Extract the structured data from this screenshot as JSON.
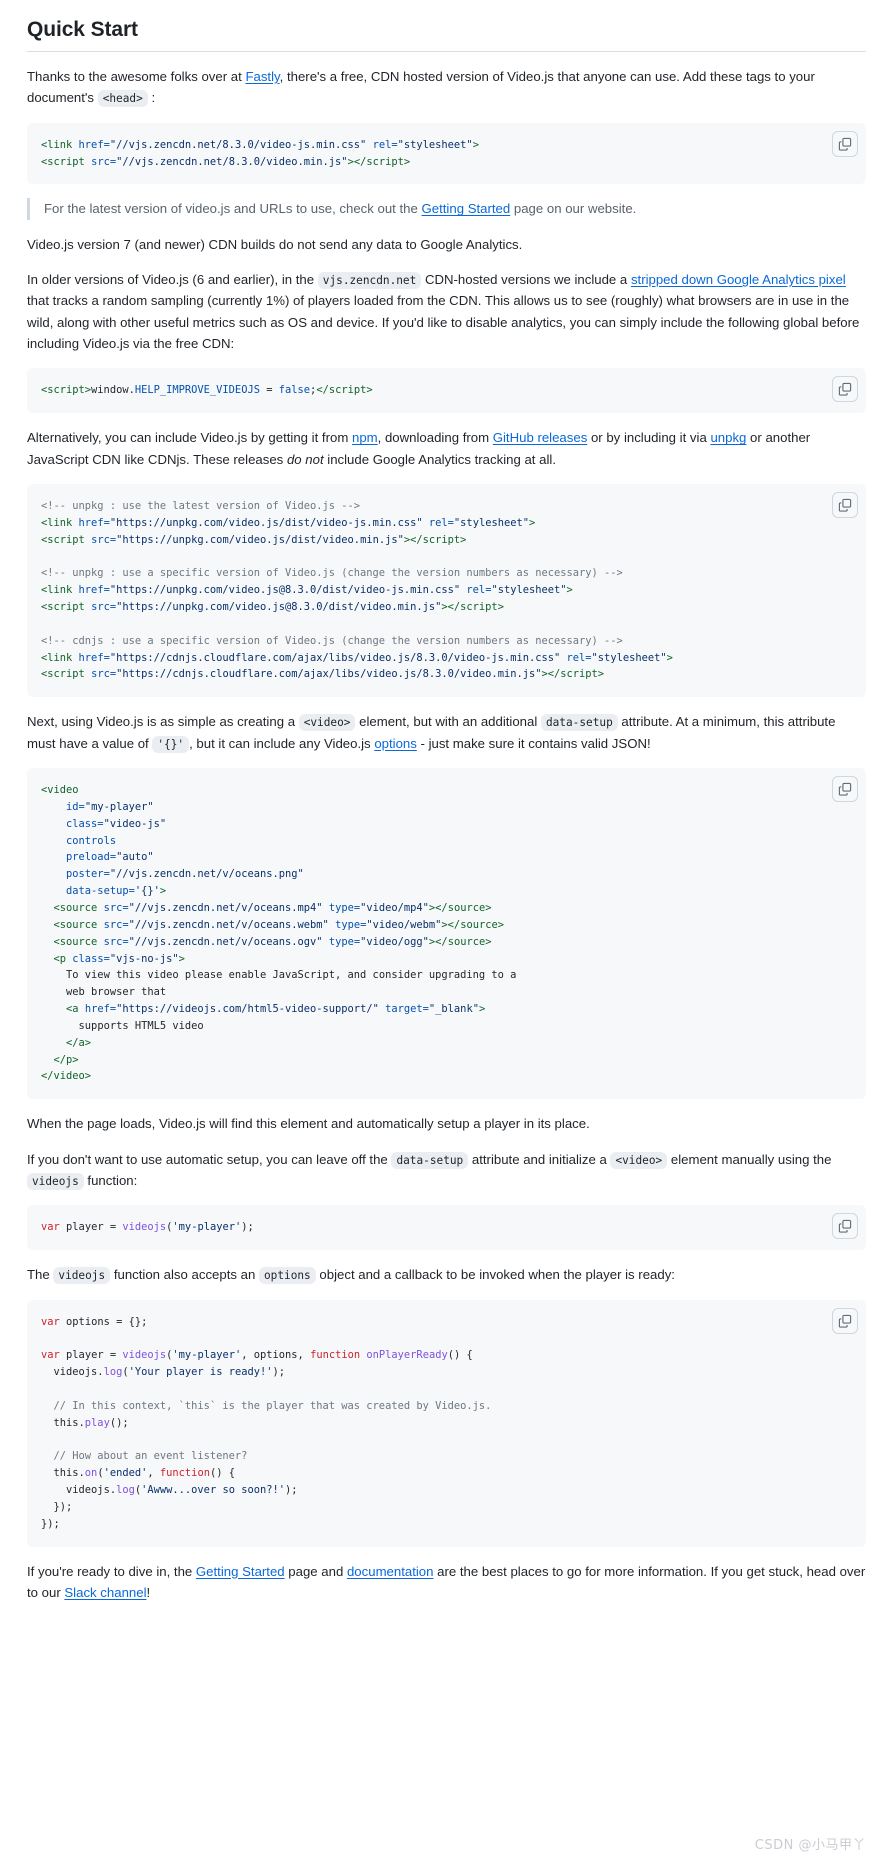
{
  "page": {
    "title": "Quick Start",
    "watermark": "CSDN @小马甲丫"
  },
  "icons": {
    "copy": "copy-icon"
  },
  "paragraphs": {
    "intro_1": "Thanks to the awesome folks over at ",
    "intro_link_fastly": "Fastly",
    "intro_2": ", there's a free, CDN hosted version of Video.js that anyone can use. Add these tags to your document's ",
    "intro_code_head": "<head>",
    "intro_3": " :",
    "note_1": "For the latest version of video.js and URLs to use, check out the ",
    "note_link": "Getting Started",
    "note_2": " page on our website.",
    "analytics_v7": "Video.js version 7 (and newer) CDN builds do not send any data to Google Analytics.",
    "older_1": "In older versions of Video.js (6 and earlier), in the ",
    "older_code_cdn": "vjs.zencdn.net",
    "older_2": " CDN-hosted versions we include a ",
    "older_link_ga": "stripped down Google Analytics pixel",
    "older_3": " that tracks a random sampling (currently 1%) of players loaded from the CDN. This allows us to see (roughly) what browsers are in use in the wild, along with other useful metrics such as OS and device. If you'd like to disable analytics, you can simply include the following global before including Video.js via the free CDN:",
    "alt_1": "Alternatively, you can include Video.js by getting it from ",
    "alt_link_npm": "npm",
    "alt_2": ", downloading from ",
    "alt_link_github": "GitHub releases",
    "alt_3": " or by including it via ",
    "alt_link_unpkg": "unpkg",
    "alt_4": " or another JavaScript CDN like CDNjs. These releases ",
    "alt_emph": "do not",
    "alt_5": " include Google Analytics tracking at all.",
    "next_1": "Next, using Video.js is as simple as creating a ",
    "next_code_video": "<video>",
    "next_2": " element, but with an additional ",
    "next_code_datasetup": "data-setup",
    "next_3": " attribute. At a minimum, this attribute must have a value of ",
    "next_code_brace": "'{}'",
    "next_4": ", but it can include any Video.js ",
    "next_link_options": "options",
    "next_5": " - just make sure it contains valid JSON!",
    "onload": "When the page loads, Video.js will find this element and automatically setup a player in its place.",
    "manual_1": "If you don't want to use automatic setup, you can leave off the ",
    "manual_code_datasetup": "data-setup",
    "manual_2": " attribute and initialize a ",
    "manual_code_video": "<video>",
    "manual_3": " element manually using the ",
    "manual_code_videojs": "videojs",
    "manual_4": " function:",
    "cb_1": "The ",
    "cb_code_videojs": "videojs",
    "cb_2": " function also accepts an ",
    "cb_code_options": "options",
    "cb_3": " object and a callback to be invoked when the player is ready:",
    "final_1": "If you're ready to dive in, the ",
    "final_link_getting": "Getting Started",
    "final_2": " page and ",
    "final_link_docs": "documentation",
    "final_3": " are the best places to go for more information. If you get stuck, head over to our ",
    "final_link_slack": "Slack channel",
    "final_4": "!"
  },
  "code_blocks": {
    "cdn_tags": "<link href=\"//vjs.zencdn.net/8.3.0/video-js.min.css\" rel=\"stylesheet\">\n<script src=\"//vjs.zencdn.net/8.3.0/video.min.js\"></script>",
    "disable_analytics": "<script>window.HELP_IMPROVE_VIDEOJS = false;</script>",
    "unpkg_cdnjs": "<!-- unpkg : use the latest version of Video.js -->\n<link href=\"https://unpkg.com/video.js/dist/video-js.min.css\" rel=\"stylesheet\">\n<script src=\"https://unpkg.com/video.js/dist/video.min.js\"></script>\n\n<!-- unpkg : use a specific version of Video.js (change the version numbers as necessary) -->\n<link href=\"https://unpkg.com/video.js@8.3.0/dist/video-js.min.css\" rel=\"stylesheet\">\n<script src=\"https://unpkg.com/video.js@8.3.0/dist/video.min.js\"></script>\n\n<!-- cdnjs : use a specific version of Video.js (change the version numbers as necessary) -->\n<link href=\"https://cdnjs.cloudflare.com/ajax/libs/video.js/8.3.0/video-js.min.css\" rel=\"stylesheet\">\n<script src=\"https://cdnjs.cloudflare.com/ajax/libs/video.js/8.3.0/video.min.js\"></script>",
    "video_element": "<video\n    id=\"my-player\"\n    class=\"video-js\"\n    controls\n    preload=\"auto\"\n    poster=\"//vjs.zencdn.net/v/oceans.png\"\n    data-setup='{}'>\n  <source src=\"//vjs.zencdn.net/v/oceans.mp4\" type=\"video/mp4\"></source>\n  <source src=\"//vjs.zencdn.net/v/oceans.webm\" type=\"video/webm\"></source>\n  <source src=\"//vjs.zencdn.net/v/oceans.ogv\" type=\"video/ogg\"></source>\n  <p class=\"vjs-no-js\">\n    To view this video please enable JavaScript, and consider upgrading to a\n    web browser that\n    <a href=\"https://videojs.com/html5-video-support/\" target=\"_blank\">\n      supports HTML5 video\n    </a>\n  </p>\n</video>",
    "manual_init": "var player = videojs('my-player');",
    "options_callback": "var options = {};\n\nvar player = videojs('my-player', options, function onPlayerReady() {\n  videojs.log('Your player is ready!');\n\n  // In this context, `this` is the player that was created by Video.js.\n  this.play();\n\n  // How about an event listener?\n  this.on('ended', function() {\n    videojs.log('Awww...over so soon?!');\n  });\n});"
  },
  "colors": {
    "link": "#0969da",
    "code_bg": "#f6f8fa",
    "inline_code_bg": "#eaeef2",
    "text": "#1f2328",
    "muted": "#59636e",
    "border": "#d0d7de"
  }
}
